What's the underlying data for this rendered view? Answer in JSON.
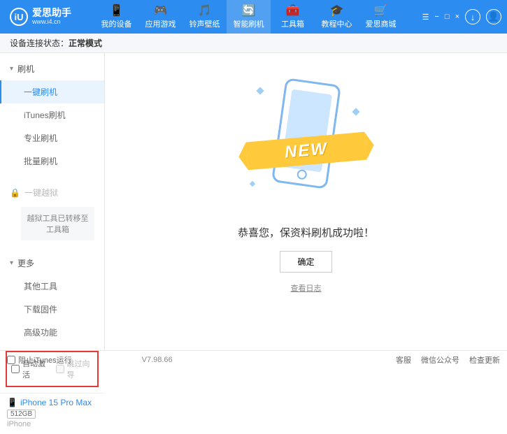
{
  "app": {
    "title": "爱思助手",
    "url": "www.i4.cn",
    "logo_letter": "iU"
  },
  "window_controls": {
    "settings": "☰",
    "minimize": "−",
    "maximize": "□",
    "close": "×"
  },
  "nav": [
    {
      "icon": "📱",
      "label": "我的设备"
    },
    {
      "icon": "🎮",
      "label": "应用游戏"
    },
    {
      "icon": "🎵",
      "label": "铃声壁纸"
    },
    {
      "icon": "🔄",
      "label": "智能刷机"
    },
    {
      "icon": "🧰",
      "label": "工具箱"
    },
    {
      "icon": "🎓",
      "label": "教程中心"
    },
    {
      "icon": "🛒",
      "label": "爱思商城"
    }
  ],
  "nav_active_index": 3,
  "header_icons": {
    "download": "↓",
    "user": "👤"
  },
  "status": {
    "label": "设备连接状态：",
    "value": "正常模式"
  },
  "sidebar": {
    "flash": {
      "head": "刷机",
      "items": [
        "一键刷机",
        "iTunes刷机",
        "专业刷机",
        "批量刷机"
      ],
      "active_index": 0
    },
    "jailbreak": {
      "head": "一键越狱",
      "note": "越狱工具已转移至工具箱"
    },
    "more": {
      "head": "更多",
      "items": [
        "其他工具",
        "下载固件",
        "高级功能"
      ]
    },
    "checks": {
      "auto_activate": "自动激活",
      "skip_guide": "跳过向导"
    },
    "device": {
      "name": "iPhone 15 Pro Max",
      "storage": "512GB",
      "type": "iPhone"
    }
  },
  "main": {
    "new_label": "NEW",
    "result_text": "恭喜您，保资料刷机成功啦！",
    "ok_button": "确定",
    "log_link": "查看日志"
  },
  "footer": {
    "block_itunes": "阻止iTunes运行",
    "version": "V7.98.66",
    "links": [
      "客服",
      "微信公众号",
      "检查更新"
    ]
  }
}
